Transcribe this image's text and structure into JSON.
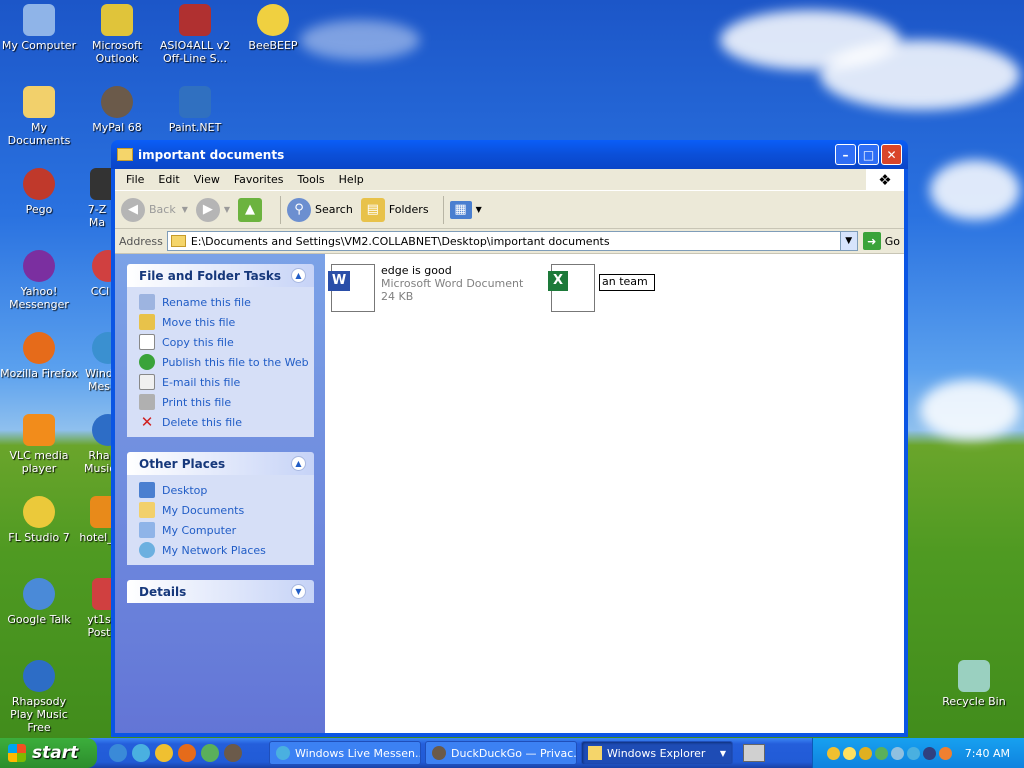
{
  "desktop": {
    "icons_col1": [
      {
        "label": "My Computer",
        "color": "#8fb4e8"
      },
      {
        "label": "My Documents",
        "color": "#f2d06b"
      },
      {
        "label": "Pego",
        "color": "#c0392b"
      },
      {
        "label": "Yahoo! Messenger",
        "color": "#7b2fa0"
      },
      {
        "label": "Mozilla Firefox",
        "color": "#e66b1a"
      },
      {
        "label": "VLC media player",
        "color": "#f28c1b"
      },
      {
        "label": "FL Studio 7",
        "color": "#ebc93a"
      },
      {
        "label": "Google Talk",
        "color": "#4a8ad8"
      },
      {
        "label": "Rhapsody Play Music Free",
        "color": "#2d6dc6"
      }
    ],
    "icons_col2": [
      {
        "label": "Microsoft Outlook",
        "color": "#e0c43a"
      },
      {
        "label": "MyPal 68",
        "color": "#6b5a4a"
      },
      {
        "label": "7-Z Ma",
        "color": "#333333"
      },
      {
        "label": "CCl",
        "color": "#d04040"
      },
      {
        "label": "Wind Mes",
        "color": "#3a90d0"
      },
      {
        "label": "Rha Music",
        "color": "#2d6dc6"
      },
      {
        "label": "hotel_",
        "color": "#e88a1a"
      },
      {
        "label": "yt1s Post",
        "color": "#d04040"
      }
    ],
    "icons_top": [
      {
        "label": "ASIO4ALL v2 Off-Line S...",
        "color": "#b03030"
      },
      {
        "label": "BeeBEEP",
        "color": "#f0d040"
      },
      {
        "label": "Paint.NET",
        "color": "#3070c0"
      }
    ],
    "recycle_bin": "Recycle Bin"
  },
  "window": {
    "title": "important documents",
    "menu": [
      "File",
      "Edit",
      "View",
      "Favorites",
      "Tools",
      "Help"
    ],
    "toolbar": {
      "back": "Back",
      "search": "Search",
      "folders": "Folders"
    },
    "address_label": "Address",
    "address_value": "E:\\Documents and Settings\\VM2.COLLABNET\\Desktop\\important documents",
    "go_label": "Go",
    "tasks_panel": {
      "title": "File and Folder Tasks",
      "items": [
        "Rename this file",
        "Move this file",
        "Copy this file",
        "Publish this file to the Web",
        "E-mail this file",
        "Print this file",
        "Delete this file"
      ]
    },
    "places_panel": {
      "title": "Other Places",
      "items": [
        "Desktop",
        "My Documents",
        "My Computer",
        "My Network Places"
      ]
    },
    "details_panel": {
      "title": "Details"
    },
    "files": [
      {
        "name": "edge is good",
        "type": "Microsoft Word Document",
        "size": "24 KB"
      },
      {
        "rename_value": "an team"
      }
    ]
  },
  "taskbar": {
    "start_label": "start",
    "tasks": [
      {
        "label": "Windows Live Messen...",
        "active": false
      },
      {
        "label": "DuckDuckGo — Privac...",
        "active": false
      },
      {
        "label": "Windows Explorer",
        "active": true
      }
    ],
    "clock": "7:40 AM"
  }
}
